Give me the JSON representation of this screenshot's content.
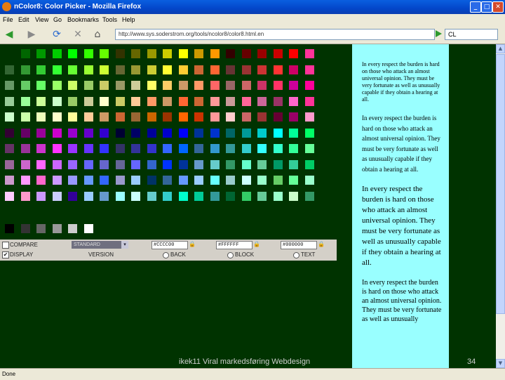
{
  "window": {
    "title": "nColor8: Color Picker - Mozilla Firefox",
    "buttons": [
      "_",
      "□",
      "✕"
    ]
  },
  "menu": [
    "File",
    "Edit",
    "View",
    "Go",
    "Bookmarks",
    "Tools",
    "Help"
  ],
  "nav": {
    "buttons": [
      "◀",
      "▶",
      "⟳",
      "✕",
      "⌂"
    ],
    "url": "http://www.sys.soderstrom.org/tools/ncolor8/color8.html.en",
    "search_value": "CL"
  },
  "palette": {
    "rows": [
      [
        "#003300",
        "#006600",
        "#009900",
        "#00cc00",
        "#00ff00",
        "#33ff00",
        "#66ff00",
        "#333300",
        "#666600",
        "#999900",
        "#cccc00",
        "#ffff00",
        "#cc9900",
        "#ff9900",
        "#330000",
        "#660000",
        "#990000",
        "#cc0000",
        "#ff0000",
        "#ff3399"
      ],
      [
        "#336633",
        "#339933",
        "#33cc33",
        "#33ff33",
        "#66ff33",
        "#99ff33",
        "#ccff33",
        "#666633",
        "#999933",
        "#cccc33",
        "#ffff33",
        "#ffcc33",
        "#cc6633",
        "#ff6633",
        "#663333",
        "#993333",
        "#cc3333",
        "#ff3333",
        "#cc0066",
        "#ff3399"
      ],
      [
        "#669966",
        "#66cc66",
        "#66ff66",
        "#99ff66",
        "#ccff66",
        "#99cc66",
        "#cccc66",
        "#999966",
        "#cccc99",
        "#ffff66",
        "#ffcc66",
        "#cc9966",
        "#ff9966",
        "#ff6666",
        "#996666",
        "#cc6666",
        "#cc3366",
        "#ff3366",
        "#cc0099",
        "#ff0099"
      ],
      [
        "#99cc99",
        "#99ff99",
        "#ccff99",
        "#ccffcc",
        "#99cc66",
        "#cccc99",
        "#ffffcc",
        "#cccc66",
        "#ffcc99",
        "#ff9966",
        "#cc9966",
        "#ff6633",
        "#cc6633",
        "#ff9999",
        "#cc9999",
        "#ff6699",
        "#cc6699",
        "#993366",
        "#ff66cc",
        "#ff3399"
      ],
      [
        "#ccffcc",
        "#ccffaa",
        "#eeffbb",
        "#ffffcc",
        "#ffff99",
        "#ffcc99",
        "#cc9966",
        "#cc6633",
        "#996633",
        "#cc6600",
        "#993300",
        "#ff6600",
        "#cc3300",
        "#ff9999",
        "#ffcccc",
        "#cc6666",
        "#993333",
        "#660033",
        "#990066",
        "#ff99cc"
      ],
      [
        "#330033",
        "#660066",
        "#990099",
        "#cc00cc",
        "#9900cc",
        "#6600cc",
        "#3300cc",
        "#000033",
        "#000066",
        "#000099",
        "#0000cc",
        "#0000ff",
        "#003399",
        "#0033cc",
        "#006666",
        "#009999",
        "#00cccc",
        "#00ffff",
        "#00ff99",
        "#00ff66"
      ],
      [
        "#663366",
        "#993399",
        "#cc33cc",
        "#ff33ff",
        "#9933ff",
        "#6633ff",
        "#3333ff",
        "#333366",
        "#333399",
        "#3333cc",
        "#3366ff",
        "#0066ff",
        "#336699",
        "#3399cc",
        "#339999",
        "#33cccc",
        "#33ffff",
        "#33ffcc",
        "#33ff99",
        "#66ff99"
      ],
      [
        "#996699",
        "#cc66cc",
        "#ff66ff",
        "#cc66ff",
        "#9966ff",
        "#6666ff",
        "#6666cc",
        "#666699",
        "#6666ff",
        "#3366cc",
        "#0033ff",
        "#003399",
        "#6699cc",
        "#66cccc",
        "#339966",
        "#66ffcc",
        "#66cc99",
        "#009966",
        "#33cc99",
        "#00cc66"
      ],
      [
        "#cc99cc",
        "#ff99ff",
        "#ff66cc",
        "#cc99ff",
        "#9999ff",
        "#6699ff",
        "#3366ff",
        "#9999cc",
        "#99ccff",
        "#003366",
        "#336699",
        "#6699ff",
        "#99ccff",
        "#66ffff",
        "#99cccc",
        "#ccffff",
        "#99ffcc",
        "#66cc66",
        "#66ff99",
        "#99ffcc"
      ],
      [
        "#ffccff",
        "#ff99cc",
        "#cc99ff",
        "#ccccff",
        "#330099",
        "#99ccff",
        "#6699cc",
        "#99ffff",
        "#ccffff",
        "#66cccc",
        "#33cccc",
        "#00ffcc",
        "#00cc99",
        "#339999",
        "#006633",
        "#33cc66",
        "#66cc99",
        "#99ffcc",
        "#ccffcc",
        "#339966"
      ]
    ],
    "grays": [
      "#000000",
      "#333333",
      "#666666",
      "#999999",
      "#cccccc",
      "#ffffff"
    ]
  },
  "controls": {
    "compare_label": "COMPARE",
    "display_label": "DISPLAY",
    "display_checked": "✔",
    "scheme_value": "STANDARD",
    "scheme_arrow": "▾",
    "version_label": "VERSION",
    "hex_fields": [
      "#CCCC00",
      "#FFFFFF",
      "#000000"
    ],
    "lock_icon": "🔒",
    "radio_labels": [
      "BACK",
      "BLOCK",
      "TEXT"
    ]
  },
  "sample_text": [
    "In every respect the burden is hard on those who attack an almost universal opinion. They must be very fortunate as well as unusually capable if they obtain a hearing at all.",
    "In every respect the burden is hard on those who attack an almost universal opinion. They must be very fortunate as well as unusually capable if they obtain a hearing at all.",
    "In every respect the burden is hard on those who attack an almost universal opinion. They must be very fortunate as well as unusually capable if they obtain a hearing at all.",
    "In every respect the burden is hard on those who attack an almost universal opinion. They must be very fortunate as well as unusually"
  ],
  "footer": {
    "text": "ikek11 Viral markedsføring Webdesign",
    "slide_number": "34"
  },
  "status": {
    "text": "Done"
  },
  "scrollbar": {
    "up": "▲",
    "down": "▼"
  }
}
